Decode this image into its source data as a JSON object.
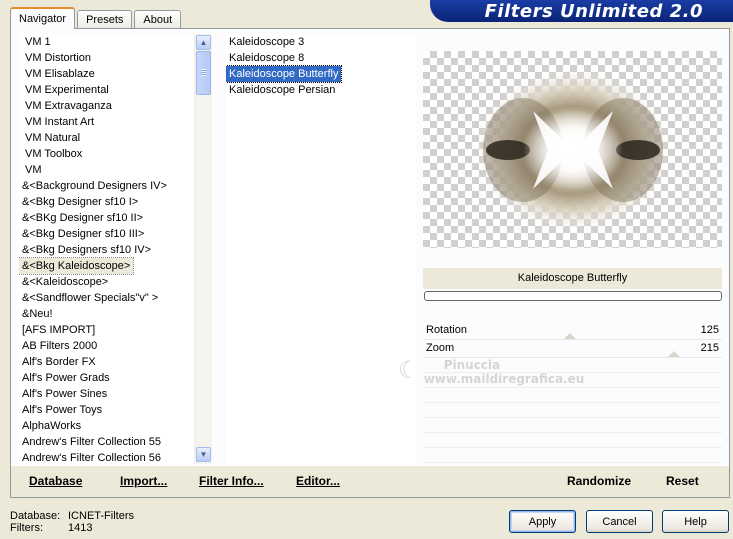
{
  "tabs": [
    {
      "label": "Navigator",
      "active": true
    },
    {
      "label": "Presets",
      "active": false
    },
    {
      "label": "About",
      "active": false
    }
  ],
  "banner": {
    "title": "Filters Unlimited 2.0"
  },
  "categories": {
    "items": [
      "VM 1",
      "VM Distortion",
      "VM Elisablaze",
      "VM Experimental",
      "VM Extravaganza",
      "VM Instant Art",
      "VM Natural",
      "VM Toolbox",
      "VM",
      "&<Background Designers IV>",
      "&<Bkg Designer sf10 I>",
      "&<BKg Designer sf10 II>",
      "&<Bkg Designer sf10 III>",
      "&<Bkg Designers sf10 IV>",
      "&<Bkg Kaleidoscope>",
      "&<Kaleidoscope>",
      "&<Sandflower Specials\"v\" >",
      "&Neu!",
      "[AFS IMPORT]",
      "AB Filters 2000",
      "Alf's Border FX",
      "Alf's Power Grads",
      "Alf's Power Sines",
      "Alf's Power Toys",
      "AlphaWorks",
      "Andrew's Filter Collection 55",
      "Andrew's Filter Collection 56"
    ],
    "selected_index": 14
  },
  "filters": {
    "items": [
      "Kaleidoscope 3",
      "Kaleidoscope 8",
      "Kaleidoscope Butterfly",
      "Kaleidoscope Persian"
    ],
    "selected_index": 2
  },
  "preview": {
    "filter_name": "Kaleidoscope Butterfly"
  },
  "params": [
    {
      "label": "Rotation",
      "value": "125",
      "level": 0.49
    },
    {
      "label": "Zoom",
      "value": "215",
      "level": 0.84
    }
  ],
  "bottom_links": {
    "database": "Database",
    "import": "Import...",
    "filter_info": "Filter Info...",
    "editor": "Editor...",
    "randomize": "Randomize",
    "reset": "Reset"
  },
  "info": {
    "database_label": "Database:",
    "database_value": "ICNET-Filters",
    "filters_label": "Filters:",
    "filters_value": "1413"
  },
  "buttons": {
    "apply": "Apply",
    "cancel": "Cancel",
    "help": "Help"
  },
  "watermark": {
    "line1": "Pinuccia",
    "line2": "www.maildiregrafica.eu"
  }
}
